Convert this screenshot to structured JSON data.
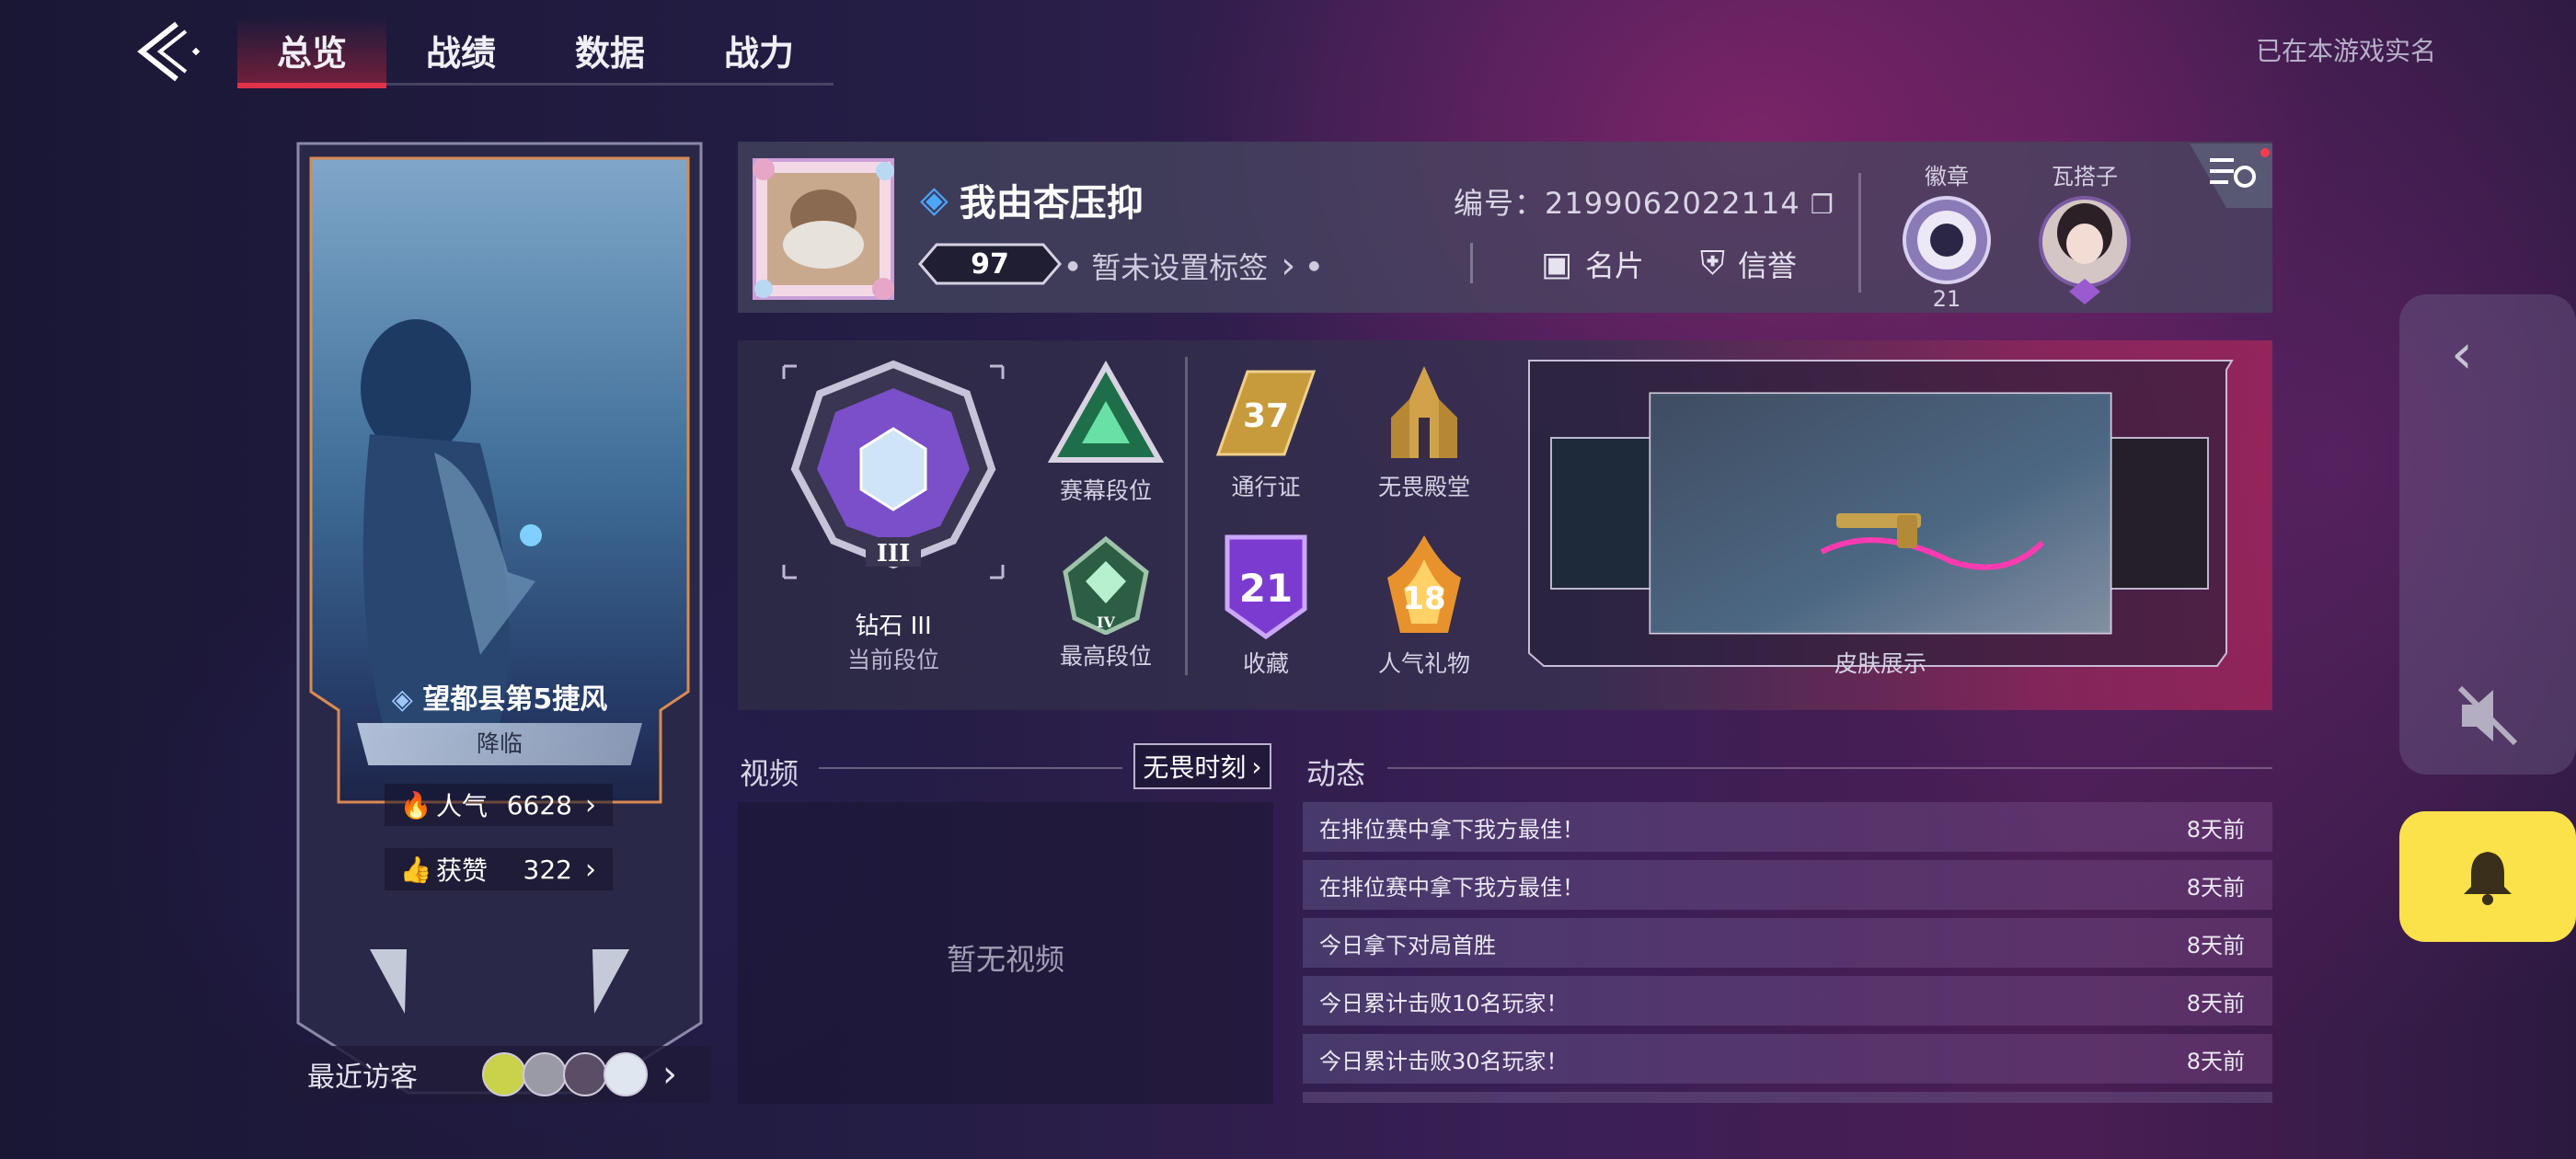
{
  "nav": {
    "tabs": [
      {
        "label": "总览",
        "active": true
      },
      {
        "label": "战绩",
        "active": false
      },
      {
        "label": "数据",
        "active": false
      },
      {
        "label": "战力",
        "active": false
      }
    ],
    "realname_notice": "已在本游戏实名"
  },
  "hero_card": {
    "player_title": "望都县第5捷风",
    "tag": "降临",
    "popularity_label": "人气",
    "popularity_value": "6628",
    "likes_label": "获赞",
    "likes_value": "322",
    "visitors_label": "最近访客"
  },
  "profile": {
    "name": "我由杏压抑",
    "level": "97",
    "tagline": "暂未设置标签",
    "id_text": "编号：2199062022114",
    "card_label": "名片",
    "credit_label": "信誉",
    "badge_label": "徽章",
    "badge_count": "21",
    "buddy_label": "瓦搭子"
  },
  "stats": {
    "current_rank_name": "钻石 III",
    "current_rank_caption": "当前段位",
    "current_rank_numeral": "III",
    "season_rank": "赛幕段位",
    "highest_rank": "最高段位",
    "highest_rank_numeral": "IV",
    "pass_label": "通行证",
    "pass_value": "37",
    "hall_label": "无畏殿堂",
    "collection_label": "收藏",
    "collection_value": "21",
    "gift_label": "人气礼物",
    "gift_value": "18",
    "skin_label": "皮肤展示"
  },
  "videos": {
    "title": "视频",
    "moment_button": "无畏时刻",
    "empty_text": "暂无视频"
  },
  "feeds": {
    "title": "动态",
    "items": [
      {
        "text": "在排位赛中拿下我方最佳！",
        "time": "8天前"
      },
      {
        "text": "在排位赛中拿下我方最佳！",
        "time": "8天前"
      },
      {
        "text": "今日拿下对局首胜",
        "time": "8天前"
      },
      {
        "text": "今日累计击败10名玩家！",
        "time": "8天前"
      },
      {
        "text": "今日累计击败30名玩家！",
        "time": "8天前"
      }
    ]
  },
  "colors": {
    "accent_red": "#e0324a",
    "bell_yellow": "#fbe14a"
  }
}
